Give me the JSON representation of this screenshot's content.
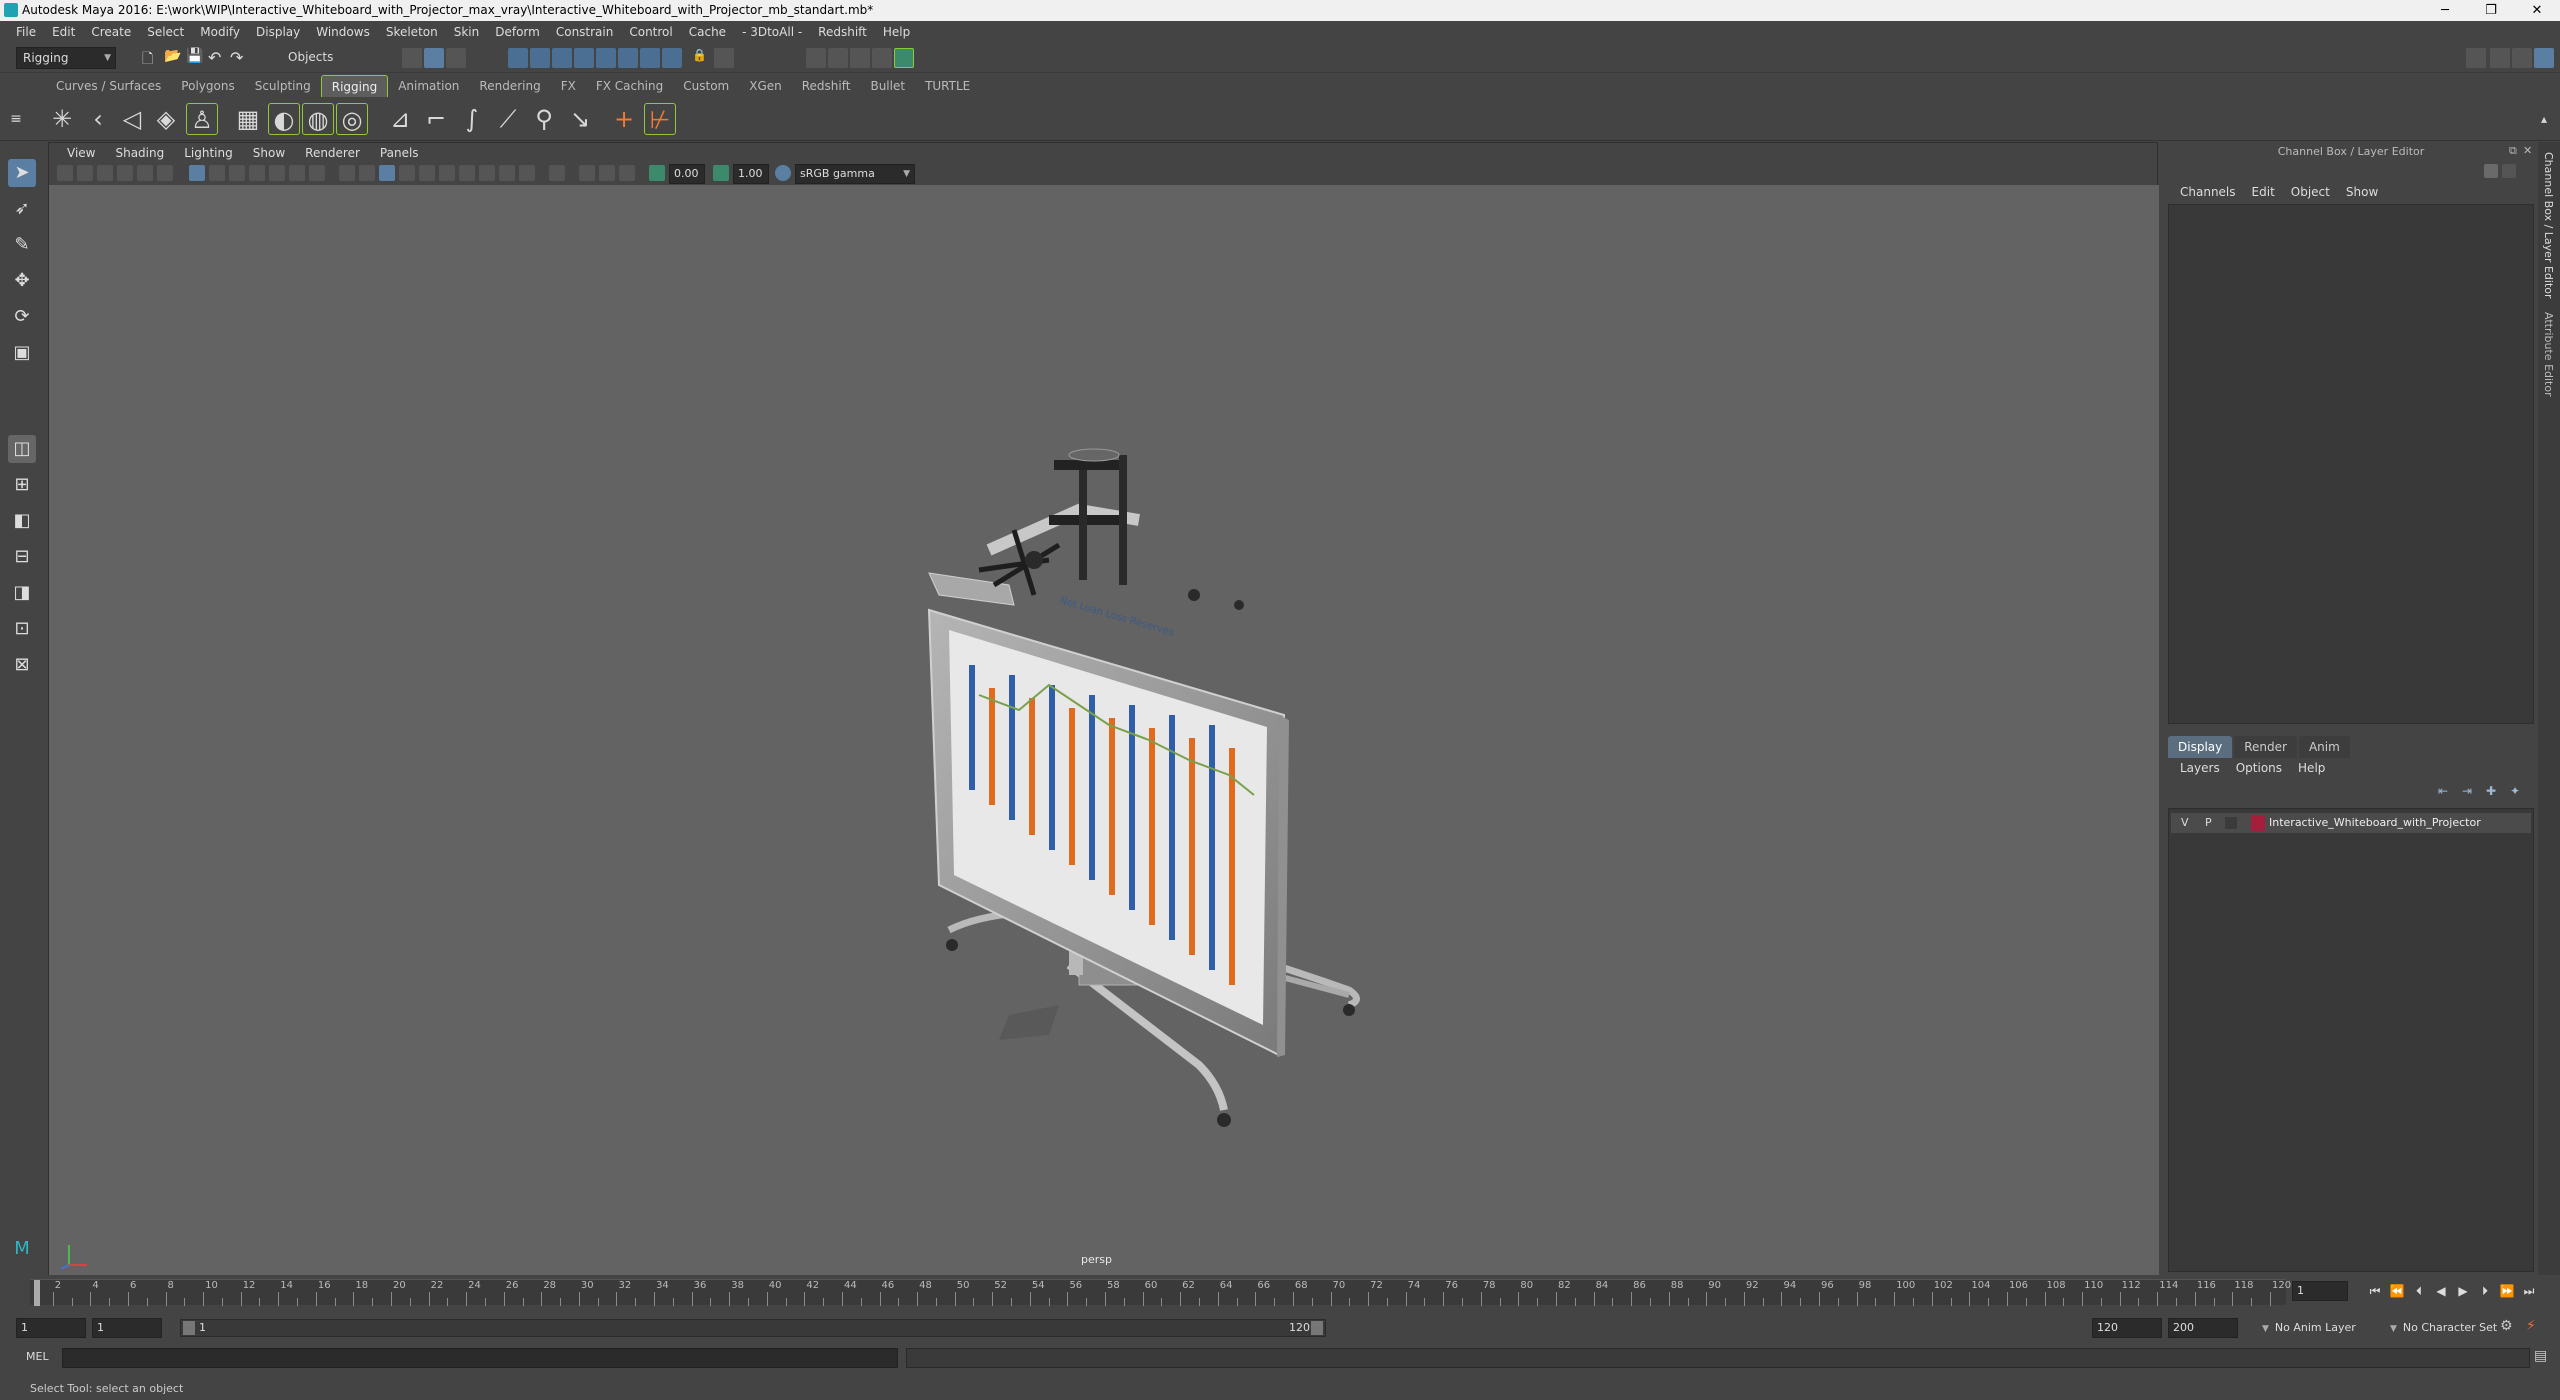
{
  "window": {
    "title": "Autodesk Maya 2016: E:\\work\\WIP\\Interactive_Whiteboard_with_Projector_max_vray\\Interactive_Whiteboard_with_Projector_mb_standart.mb*",
    "minimize": "─",
    "restore": "❐",
    "close": "✕"
  },
  "menubar": [
    "File",
    "Edit",
    "Create",
    "Select",
    "Modify",
    "Display",
    "Windows",
    "Skeleton",
    "Skin",
    "Deform",
    "Constrain",
    "Control",
    "Cache",
    "- 3DtoAll -",
    "Redshift",
    "Help"
  ],
  "statusline": {
    "menuset": "Rigging",
    "selection_mode": "Objects"
  },
  "shelf_tabs": [
    "Curves / Surfaces",
    "Polygons",
    "Sculpting",
    "Rigging",
    "Animation",
    "Rendering",
    "FX",
    "FX Caching",
    "Custom",
    "XGen",
    "Redshift",
    "Bullet",
    "TURTLE"
  ],
  "shelf_active_tab": "Rigging",
  "viewport": {
    "menu": [
      "View",
      "Shading",
      "Lighting",
      "Show",
      "Renderer",
      "Panels"
    ],
    "exposure": "0.00",
    "gamma": "1.00",
    "color_space": "sRGB gamma",
    "camera_label": "persp"
  },
  "whiteboard_chart": {
    "title": "Net Loan Loss Reserves"
  },
  "channel_box": {
    "title": "Channel Box / Layer Editor",
    "menu": [
      "Channels",
      "Edit",
      "Object",
      "Show"
    ]
  },
  "layer_editor": {
    "tabs": [
      "Display",
      "Render",
      "Anim"
    ],
    "active_tab": "Display",
    "menu": [
      "Layers",
      "Options",
      "Help"
    ],
    "layers": [
      {
        "visible": "V",
        "playback": "P",
        "color": "#a51f3c",
        "name": "Interactive_Whiteboard_with_Projector"
      }
    ]
  },
  "side_tabs": [
    "Channel Box / Layer Editor",
    "Attribute Editor"
  ],
  "timeline": {
    "ticks": [
      "2",
      "4",
      "6",
      "8",
      "10",
      "12",
      "14",
      "16",
      "18",
      "20",
      "22",
      "24",
      "26",
      "28",
      "30",
      "32",
      "34",
      "36",
      "38",
      "40",
      "42",
      "44",
      "46",
      "48",
      "50",
      "52",
      "54",
      "56",
      "58",
      "60",
      "62",
      "64",
      "66",
      "68",
      "70",
      "72",
      "74",
      "76",
      "78",
      "80",
      "82",
      "84",
      "86",
      "88",
      "90",
      "92",
      "94",
      "96",
      "98",
      "100",
      "102",
      "104",
      "106",
      "108",
      "110",
      "112",
      "114",
      "116",
      "118",
      "120"
    ],
    "current_frame": "1",
    "range_start": "1",
    "range_start_inner": "1",
    "range_bar_start": "1",
    "range_bar_end": "120",
    "range_end_inner": "120",
    "range_end": "200",
    "anim_layer": "No Anim Layer",
    "character_set": "No Character Set"
  },
  "command_line": {
    "label": "MEL"
  },
  "help_line": "Select Tool: select an object"
}
